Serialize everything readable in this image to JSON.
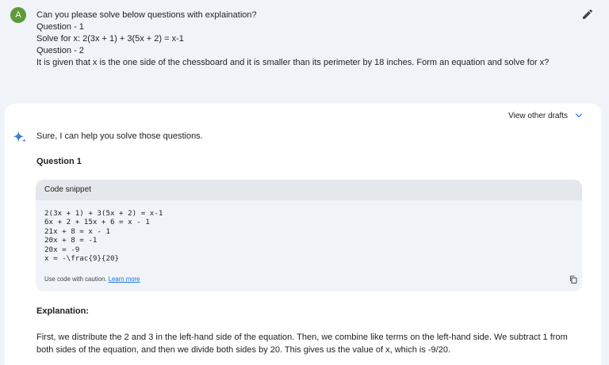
{
  "user": {
    "avatar_letter": "A",
    "lines": [
      "Can you please solve below questions with explaination?",
      "",
      "Question - 1",
      "Solve for x: 2(3x + 1) + 3(5x + 2) = x-1",
      "",
      "Question - 2",
      "It is given that x is the one side of the chessboard and it is smaller than its perimeter by 18 inches. Form an equation and solve for x?"
    ]
  },
  "response": {
    "view_drafts_label": "View other drafts",
    "intro": "Sure, I can help you solve those questions.",
    "question_heading": "Question 1",
    "code": {
      "header": "Code snippet",
      "lines": [
        "2(3x + 1) + 3(5x + 2) = x-1",
        "6x + 2 + 15x + 6 = x - 1",
        "21x + 8 = x - 1",
        "20x + 8 = -1",
        "20x = -9",
        "x = -\\frac{9}{20}"
      ],
      "caution": "Use code with caution.",
      "learn_more": "Learn more"
    },
    "explanation_heading": "Explanation:",
    "explanation_text": "First, we distribute the 2 and 3 in the left-hand side of the equation. Then, we combine like terms on the left-hand side. We subtract 1 from both sides of the equation, and then we divide both sides by 20. This gives us the value of x, which is -9/20."
  },
  "colors": {
    "avatar": "#5f9b3a",
    "link": "#1a73e8",
    "background": "#f0f4f9"
  }
}
